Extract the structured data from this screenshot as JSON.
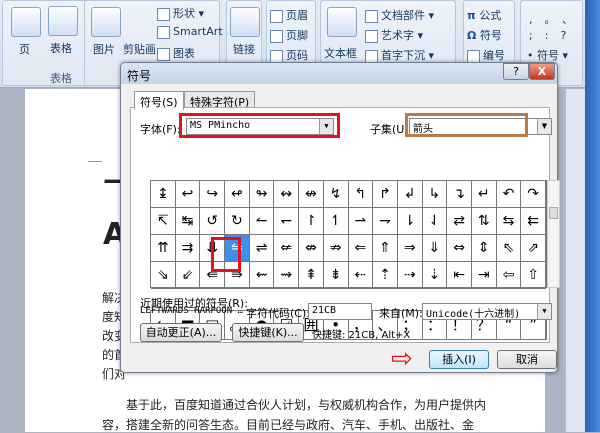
{
  "ribbon": {
    "page": "页",
    "table": "表格",
    "table_group": "表格",
    "picture": "图片",
    "clipart": "剪贴画",
    "shapes": "形状",
    "smartart": "SmartArt",
    "chart": "图表",
    "link": "链接",
    "header": "页眉",
    "footer": "页脚",
    "page_number": "页码",
    "textbox": "文本框",
    "quick_parts": "文档部件",
    "wordart": "艺术字",
    "dropcap": "首字下沉",
    "equation": "公式",
    "symbol": "符号",
    "numbering": "编号",
    "symbol2": "符号",
    "punct": [
      ",",
      "。",
      "、",
      ";",
      ":",
      "?"
    ]
  },
  "document": {
    "heading1": "飞",
    "heading2": "A",
    "para1_lines": [
      "解决",
      "度知",
      "改变",
      "的首",
      "们对"
    ],
    "para2_lines": [
      "　　基于此，百度知道通过合伙人计划，与权威机构合作，为用户提供内",
      "容，搭建全新的问答生态。目前已经与政府、汽车、手机、出版社、金"
    ]
  },
  "dialog": {
    "title": "符号",
    "help": "?",
    "close": "X",
    "tabs": [
      "符号(S)",
      "特殊字符(P)"
    ],
    "font_label": "字体(F):",
    "font_value": "MS PMincho",
    "subset_label": "子集(U):",
    "subset_value": "箭头",
    "symbols": [
      [
        "↨",
        "↩",
        "↪",
        "↫",
        "↬",
        "↭",
        "↮",
        "↯",
        "↰",
        "↱",
        "↲",
        "↳",
        "↴",
        "↵",
        "↶",
        "↷"
      ],
      [
        "↸",
        "↹",
        "↺",
        "↻",
        "↼",
        "↽",
        "↾",
        "↿",
        "⇀",
        "⇁",
        "⇂",
        "⇃",
        "⇄",
        "⇅",
        "⇆",
        "⇇"
      ],
      [
        "⇈",
        "⇉",
        "⇊",
        "⇋",
        "⇌",
        "⇍",
        "⇎",
        "⇏",
        "⇐",
        "⇑",
        "⇒",
        "⇓",
        "⇔",
        "⇕",
        "⇖",
        "⇗"
      ],
      [
        "⇘",
        "⇙",
        "⇚",
        "⇛",
        "⇜",
        "⇝",
        "⇞",
        "⇟",
        "⇠",
        "⇡",
        "⇢",
        "⇣",
        "⇤",
        "⇥",
        "⇦",
        "⇧"
      ]
    ],
    "selected": "⇋",
    "recent_label": "近期使用过的符号(R):",
    "recent": [
      "⇋",
      "■",
      "□",
      "。",
      "●",
      "☑",
      "囲",
      "•",
      "，",
      "、",
      "；",
      "：",
      "！",
      "？",
      "“",
      "”"
    ],
    "char_name": "LEFTWARDS HARPOON …",
    "code_label": "字符代码(C):",
    "code_value": "21CB",
    "from_label": "来自(M):",
    "from_value": "Unicode(十六进制)",
    "autocorrect": "自动更正(A)...",
    "shortcut_key": "快捷键(K)...",
    "shortcut_text": "快捷键: 21CB, Alt+X",
    "insert": "插入(I)",
    "cancel": "取消"
  },
  "colors": {
    "highlight_red": "#e0151b",
    "highlight_brown": "#b87a4b",
    "selection": "#3d8ff0"
  }
}
